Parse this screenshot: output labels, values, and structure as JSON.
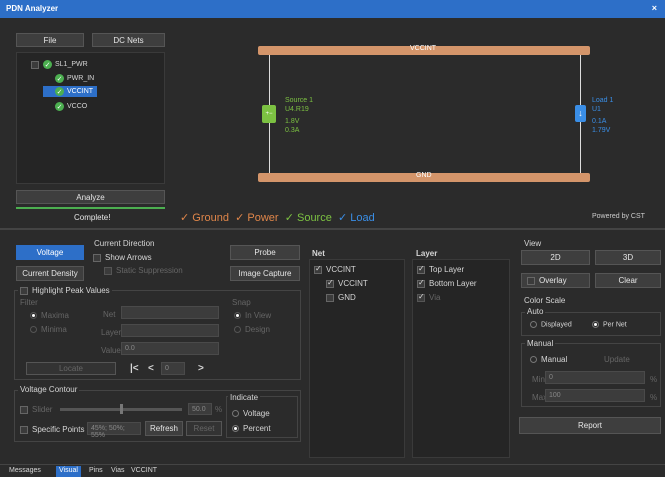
{
  "window": {
    "title": "PDN Analyzer",
    "close": "×"
  },
  "top_buttons": {
    "file": "File",
    "dc_nets": "DC Nets"
  },
  "tree": {
    "root": "SL1_PWR",
    "items": [
      "PWR_IN",
      "VCCINT",
      "VCCO"
    ],
    "selected": "VCCINT"
  },
  "analyze": {
    "button": "Analyze",
    "status": "Complete!"
  },
  "legend": [
    {
      "label": "Ground",
      "color": "#e0864a"
    },
    {
      "label": "Power",
      "color": "#e0864a"
    },
    {
      "label": "Source",
      "color": "#7cc142"
    },
    {
      "label": "Load",
      "color": "#3a8ee6"
    }
  ],
  "powered_by": "Powered by CST",
  "diagram": {
    "top_net": "VCCINT",
    "bottom_net": "GND",
    "source": {
      "title": "Source 1",
      "ref": "U4.R19",
      "voltage": "1.8V",
      "current": "0.3A"
    },
    "load": {
      "title": "Load 1",
      "ref": "U1",
      "v1": "0.1A",
      "v2": "1.79V"
    }
  },
  "left_buttons": {
    "voltage": "Voltage",
    "current_density": "Current Density",
    "probe": "Probe",
    "image_capture": "Image Capture"
  },
  "current_direction": {
    "title": "Current Direction",
    "show_arrows": "Show Arrows",
    "static_suppression": "Static Suppression"
  },
  "peak": {
    "title": "Highlight Peak Values",
    "filter": "Filter",
    "maxima": "Maxima",
    "minima": "Minima",
    "net": "Net",
    "layer": "Layer",
    "value": "Value",
    "value_text": "0.0",
    "locate": "Locate",
    "snap": "Snap",
    "in_view": "In View",
    "design": "Design",
    "nav_first": "|<",
    "nav_prev": "<",
    "nav_value": "0",
    "nav_next": ">"
  },
  "contour": {
    "title": "Voltage Contour",
    "slider": "Slider",
    "slider_value": "50.0",
    "percent": "%",
    "specific_points": "Specific Points",
    "points_value": "45%; 50%; 55%",
    "refresh": "Refresh",
    "reset": "Reset",
    "indicate": "Indicate",
    "ind_voltage": "Voltage",
    "ind_percent": "Percent"
  },
  "net_panel": {
    "title": "Net",
    "items": [
      {
        "label": "VCCINT",
        "checked": true
      },
      {
        "label": "VCCINT",
        "checked": true
      },
      {
        "label": "GND",
        "checked": false
      }
    ]
  },
  "layer_panel": {
    "title": "Layer",
    "items": [
      {
        "label": "Top Layer",
        "checked": true
      },
      {
        "label": "Bottom Layer",
        "checked": true
      },
      {
        "label": "Via",
        "checked": true
      }
    ]
  },
  "view": {
    "title": "View",
    "b2d": "2D",
    "b3d": "3D",
    "overlay": "Overlay",
    "clear": "Clear"
  },
  "color_scale": {
    "title": "Color Scale",
    "auto": "Auto",
    "displayed": "Displayed",
    "per_net": "Per Net",
    "manual_group": "Manual",
    "manual": "Manual",
    "update": "Update",
    "min_label": "Min",
    "min_value": "0",
    "max_label": "Max",
    "max_value": "100",
    "unit": "%"
  },
  "report": "Report",
  "bottom_tabs": [
    "Messages",
    "Visual",
    "Pins",
    "Vias",
    "VCCINT"
  ],
  "active_tab": "Visual"
}
